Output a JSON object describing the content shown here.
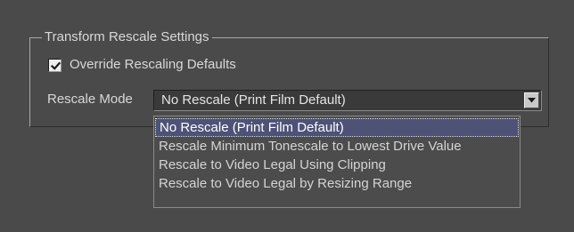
{
  "group": {
    "title": "Transform Rescale Settings"
  },
  "override_checkbox": {
    "label": "Override Rescaling Defaults",
    "checked": true
  },
  "rescale_mode": {
    "label": "Rescale Mode",
    "selected": "No Rescale (Print Film Default)",
    "options": [
      "No Rescale (Print Film Default)",
      "Rescale Minimum Tonescale to Lowest Drive Value",
      "Rescale to Video Legal Using Clipping",
      "Rescale to Video Legal by Resizing Range"
    ],
    "highlighted_index": 0
  },
  "icons": {
    "checkbox_check": "check-icon",
    "combo_arrow": "chevron-down-icon"
  },
  "colors": {
    "background": "#4a4a4a",
    "selection": "#4d5276",
    "text": "#d8d8d8"
  }
}
